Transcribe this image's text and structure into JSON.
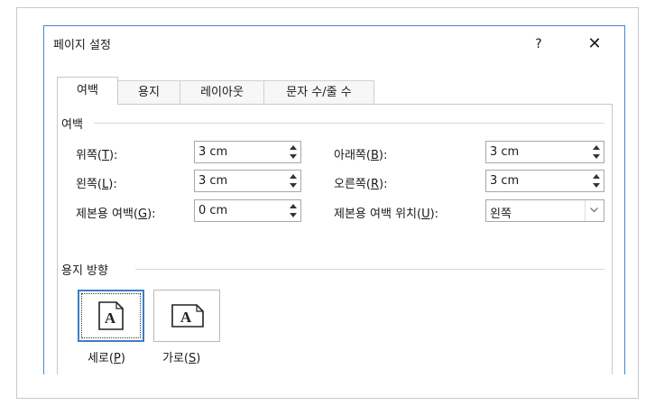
{
  "dialog": {
    "title": "페이지 설정",
    "help_label": "?",
    "close_label": "✕"
  },
  "tabs": [
    {
      "label": "여백",
      "active": true
    },
    {
      "label": "용지",
      "active": false
    },
    {
      "label": "레이아웃",
      "active": false
    },
    {
      "label": "문자 수/줄 수",
      "active": false
    }
  ],
  "margins": {
    "group_label": "여백",
    "top": {
      "label": "위쪽(",
      "key": "T",
      "suffix": "):",
      "value": "3 cm"
    },
    "bottom": {
      "label": "아래쪽(",
      "key": "B",
      "suffix": "):",
      "value": "3 cm"
    },
    "left": {
      "label": "왼쪽(",
      "key": "L",
      "suffix": "):",
      "value": "3 cm"
    },
    "right": {
      "label": "오른쪽(",
      "key": "R",
      "suffix": "):",
      "value": "3 cm"
    },
    "gutter": {
      "label": "제본용 여백(",
      "key": "G",
      "suffix": "):",
      "value": "0 cm"
    },
    "gutter_position": {
      "label": "제본용 여백 위치(",
      "key": "U",
      "suffix": "):",
      "value": "왼쪽"
    }
  },
  "orientation": {
    "group_label": "용지 방향",
    "portrait": {
      "label": "세로(",
      "key": "P",
      "suffix": ")",
      "selected": true
    },
    "landscape": {
      "label": "가로(",
      "key": "S",
      "suffix": ")",
      "selected": false
    }
  },
  "colors": {
    "accent": "#3c7fc4",
    "dialog_border": "#4a88c8"
  }
}
